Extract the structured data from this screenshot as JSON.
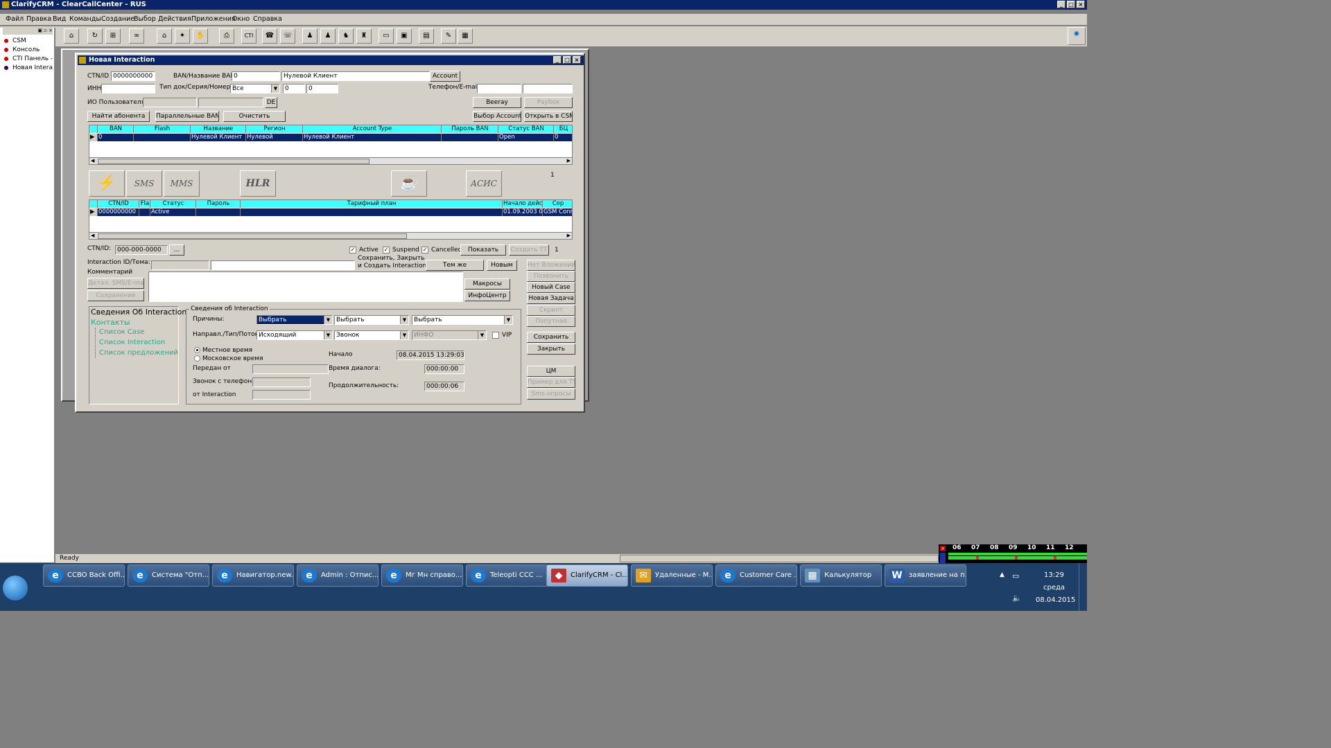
{
  "app": {
    "title": "ClarifyCRM - ClearCallCenter - RUS",
    "status": "Ready"
  },
  "menu": [
    "Файл",
    "Правка",
    "Вид",
    "Команды",
    "Создание",
    "Выбор",
    "Действия",
    "Приложения",
    "Окно",
    "Справка"
  ],
  "toolbar": {
    "cti_label": "CTI"
  },
  "left_panel": [
    "CSM",
    "Консоль",
    "CTI Панель -",
    "Новая Intera"
  ],
  "dialog": {
    "title": "Новая Interaction",
    "ctn_label": "CTN/ID",
    "ctn_value": "0000000000",
    "ban_label": "BAN/Название BAN",
    "ban_value": "0",
    "ban_name_value": "Нулевой Клиент",
    "account_btn": "Account",
    "inn_label": "ИНН",
    "doctype_label": "Тип док/Серия/Номер",
    "doctype_value": "Все",
    "series_value": "0",
    "number_value": "0",
    "phone_label": "Телефон/E-mail",
    "io_label": "ИО Пользователя",
    "de_btn": "DE",
    "veeray_btn": "Beeray",
    "paybox_btn": "Paybox",
    "find_btn": "Найти абонента",
    "parallel_btn": "Параллельные BAN",
    "clear_btn": "Очистить",
    "select_account_btn": "Выбор Account",
    "open_csm_btn": "Открыть в CSM",
    "ban_grid": {
      "headers": [
        "BAN",
        "Flash",
        "Название",
        "Регион",
        "Account Type",
        "Пароль BAN",
        "Статус BAN",
        "БЦ"
      ],
      "row": [
        "0",
        "",
        "Нулевой Клиент",
        "Нулевой",
        "Нулевой Клиент",
        "",
        "Open",
        "0"
      ]
    },
    "icons": {
      "sms": "SMS",
      "mms": "MMS",
      "hlr": "HLR",
      "acis": "АСИС",
      "count": "1"
    },
    "ctn_grid": {
      "headers": [
        "CTN/ID",
        "Fla",
        "Статус",
        "Пароль",
        "Тарифный план",
        "Начало дейс",
        "Сер"
      ],
      "row": [
        "0000000000",
        "",
        "Active",
        "",
        "",
        "01.09.2003 0",
        "GSM Conn"
      ]
    },
    "ctn_id_label": "CTN/ID:",
    "ctn_id_value": "000-000-0000",
    "dots_btn": "...",
    "active_label": "Active",
    "suspend_label": "Suspend",
    "cancelled_label": "Cancelled",
    "show_btn": "Показать",
    "create_tt_btn": "Создать ТТ",
    "tt_count": "1",
    "interaction_topic_label": "Interaction ID/Тема:",
    "save_close_label": "Сохранить, Закрыть и Создать Interaction с",
    "same_btn": "Тем же",
    "new_btn": "Новым",
    "no_attach_btn": "Нет Вложений",
    "comment_label": "Комментарий",
    "detail_sms_btn": "Детал. SMS/E-mail",
    "macros_btn": "Макросы",
    "infocenter_btn": "ИнфоЦентр",
    "call_btn": "Позвонить",
    "new_case_btn": "Новый Case",
    "new_task_btn": "Новая Задача",
    "saving_btn": "Сохранение",
    "script_btn": "Скрипт",
    "related_btn": "Попутная",
    "save_btn": "Сохранить",
    "close_btn": "Закрыть",
    "cm_btn": "ЦМ",
    "tt_example_btn": "Пример для ТТ",
    "sms_polls_btn": "Sms-опросы",
    "tree": [
      "Сведения Об Interaction",
      "Контакты",
      "Список Case",
      "Список Interaction",
      "Список предложений"
    ],
    "info_group_title": "Сведения об Interaction",
    "reasons_label": "Причины:",
    "reason_values": [
      "Выбрать",
      "Выбрать",
      "Выбрать"
    ],
    "direction_label": "Направл./Тип/Поток:",
    "direction_value": "Исходящий",
    "type_value": "Звонок",
    "flow_value": "ИНФО",
    "vip_label": "VIP",
    "local_time_label": "Местное время",
    "moscow_time_label": "Московское время",
    "start_label": "Начало",
    "start_value": "08.04.2015 13:29:03",
    "transferred_label": "Передан от",
    "dialog_time_label": "Время диалога:",
    "dialog_time_value": "000:00:00",
    "call_from_label": "Звонок с телефона",
    "duration_label": "Продолжительность:",
    "duration_value": "000:00:06",
    "from_interaction_label": "от Interaction"
  },
  "timeline_hours": [
    "06",
    "07",
    "08",
    "09",
    "10",
    "11",
    "12"
  ],
  "taskbar": {
    "items": [
      "CCBO Back Offi...",
      "Система \"Отп...",
      "Навигатор.new...",
      "Admin : Отпис...",
      "Мг Мн справо...",
      "Teleopti CCC ...",
      "ClarifyCRM - Cl...",
      "Удаленные - М...",
      "Customer Care ...",
      "Калькулятор",
      "заявление на п..."
    ],
    "time": "13:29",
    "day": "среда",
    "date": "08.04.2015"
  },
  "colors": {
    "title_bg": "#0a246a",
    "grid_header": "#40ffff",
    "selected_row": "#0a246a",
    "taskbar": "#1d3f68"
  }
}
